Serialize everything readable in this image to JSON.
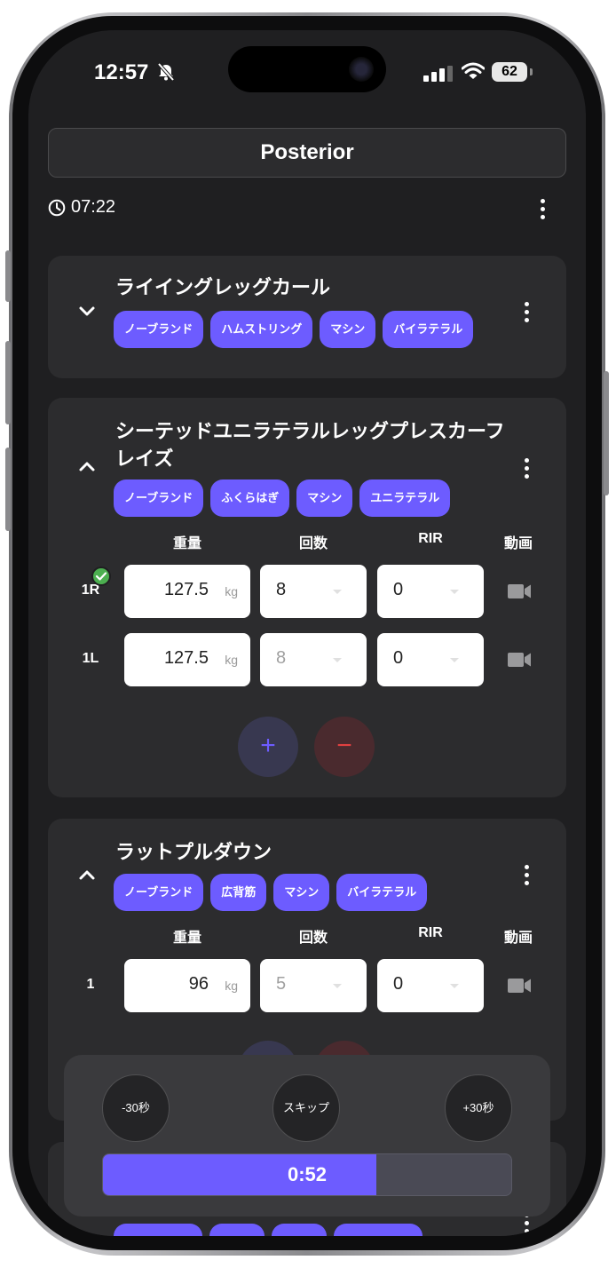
{
  "status_bar": {
    "time": "12:57",
    "battery": "62"
  },
  "workout": {
    "title": "Posterior",
    "elapsed": "07:22"
  },
  "columns": {
    "weight": "重量",
    "reps": "回数",
    "rir": "RIR",
    "video": "動画"
  },
  "exercises": [
    {
      "name": "ライイングレッグカール",
      "expanded": false,
      "tags": [
        "ノーブランド",
        "ハムストリング",
        "マシン",
        "バイラテラル"
      ]
    },
    {
      "name": "シーテッドユニラテラルレッグプレスカーフレイズ",
      "expanded": true,
      "tags": [
        "ノーブランド",
        "ふくらはぎ",
        "マシン",
        "ユニラテラル"
      ],
      "sets": [
        {
          "label": "1R",
          "completed": true,
          "weight": "127.5",
          "unit": "kg",
          "reps": "8",
          "rir": "0"
        },
        {
          "label": "1L",
          "completed": false,
          "weight": "127.5",
          "unit": "kg",
          "reps": "8",
          "rir": "0"
        }
      ],
      "add_label": "+",
      "remove_label": "−"
    },
    {
      "name": "ラットプルダウン",
      "expanded": true,
      "tags": [
        "ノーブランド",
        "広背筋",
        "マシン",
        "バイラテラル"
      ],
      "sets": [
        {
          "label": "1",
          "completed": false,
          "weight": "96",
          "unit": "kg",
          "reps": "5",
          "rir": "0"
        }
      ]
    }
  ],
  "rest_timer": {
    "minus_label": "-30秒",
    "skip_label": "スキップ",
    "plus_label": "+30秒",
    "remaining": "0:52",
    "progress_fraction": 0.67
  },
  "colors": {
    "accent": "#6d5cff",
    "card": "#2c2c2e",
    "background": "#1f1f21",
    "check": "#4caf50",
    "minus": "#e04040"
  }
}
